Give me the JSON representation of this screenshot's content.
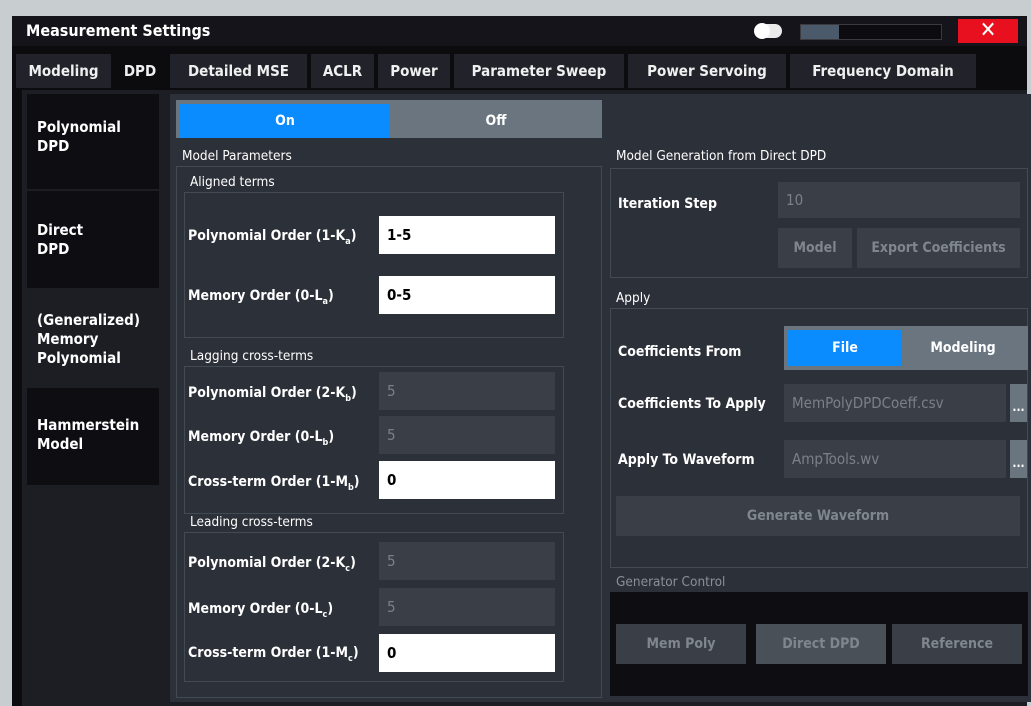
{
  "window": {
    "title": "Measurement Settings",
    "close_label": "✕",
    "transparency_fill": 0.27
  },
  "tabs": [
    "Modeling",
    "DPD",
    "Detailed MSE",
    "ACLR",
    "Power",
    "Parameter Sweep",
    "Power Servoing",
    "Frequency Domain"
  ],
  "active_tab": "DPD",
  "subtabs": [
    [
      "Polynomial",
      "DPD"
    ],
    [
      "Direct",
      "DPD"
    ],
    [
      "(Generalized)",
      "Memory",
      "Polynomial"
    ],
    [
      "Hammerstein",
      "Model"
    ]
  ],
  "onoff": {
    "on": "On",
    "off": "Off",
    "selected": "On"
  },
  "model_params": {
    "title": "Model Parameters",
    "aligned": {
      "title": "Aligned terms",
      "poly": {
        "label": "Polynomial Order (1-K",
        "sub": "a",
        "close": ")",
        "value": "1-5"
      },
      "mem": {
        "label": "Memory Order (0-L",
        "sub": "a",
        "close": ")",
        "value": "0-5"
      }
    },
    "lagging": {
      "title": "Lagging cross-terms",
      "poly": {
        "label": "Polynomial Order (2-K",
        "sub": "b",
        "close": ")",
        "value": "5"
      },
      "mem": {
        "label": "Memory Order (0-L",
        "sub": "b",
        "close": ")",
        "value": "5"
      },
      "cross": {
        "label": "Cross-term Order (1-M",
        "sub": "b",
        "close": ")",
        "value": "0"
      }
    },
    "leading": {
      "title": "Leading cross-terms",
      "poly": {
        "label": "Polynomial Order (2-K",
        "sub": "c",
        "close": ")",
        "value": "5"
      },
      "mem": {
        "label": "Memory Order (0-L",
        "sub": "c",
        "close": ")",
        "value": "5"
      },
      "cross": {
        "label": "Cross-term Order (1-M",
        "sub": "c",
        "close": ")",
        "value": "0"
      }
    }
  },
  "model_gen": {
    "title": "Model Generation from Direct DPD",
    "iteration_label": "Iteration Step",
    "iteration_value": "10",
    "model_btn": "Model",
    "export_btn": "Export Coefficients"
  },
  "apply": {
    "title": "Apply",
    "coeff_from_label": "Coefficients From",
    "file_label": "File",
    "modeling_label": "Modeling",
    "coeff_apply_label": "Coefficients To Apply",
    "coeff_apply_value": "MemPolyDPDCoeff.csv",
    "waveform_label": "Apply To Waveform",
    "waveform_value": "AmpTools.wv",
    "browse": "...",
    "generate_btn": "Generate Waveform"
  },
  "gen_control": {
    "title": "Generator Control",
    "mem_poly": "Mem Poly",
    "direct_dpd": "Direct DPD",
    "reference": "Reference"
  },
  "colors": {
    "accent": "#0a8cff",
    "close": "#e8101e",
    "titlebar": "#14141a",
    "panel": "#2c3038"
  }
}
